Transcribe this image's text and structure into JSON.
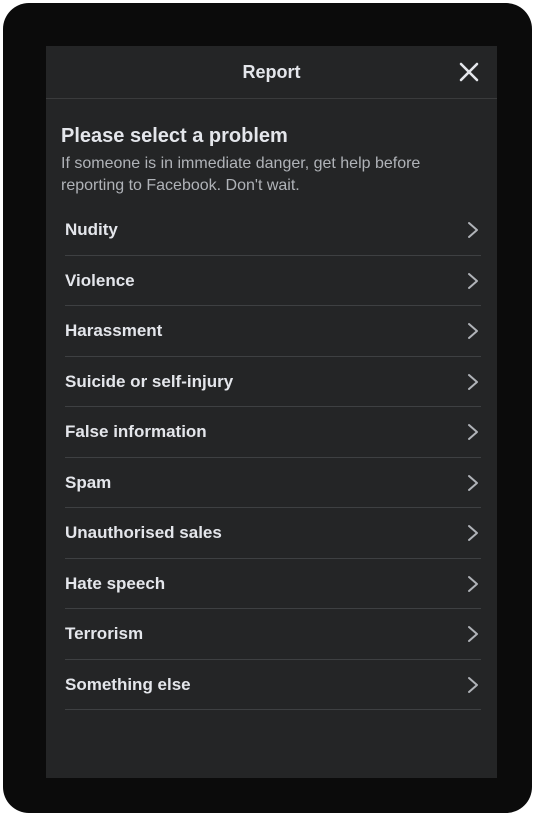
{
  "dialog": {
    "title": "Report",
    "close_icon": "close-icon"
  },
  "prompt": {
    "title": "Please select a problem",
    "subtitle": "If someone is in immediate danger, get help before reporting to Facebook. Don't wait."
  },
  "options": [
    {
      "label": "Nudity",
      "icon": "chevron-right-icon"
    },
    {
      "label": "Violence",
      "icon": "chevron-right-icon"
    },
    {
      "label": "Harassment",
      "icon": "chevron-right-icon"
    },
    {
      "label": "Suicide or self-injury",
      "icon": "chevron-right-icon"
    },
    {
      "label": "False information",
      "icon": "chevron-right-icon"
    },
    {
      "label": "Spam",
      "icon": "chevron-right-icon"
    },
    {
      "label": "Unauthorised sales",
      "icon": "chevron-right-icon"
    },
    {
      "label": "Hate speech",
      "icon": "chevron-right-icon"
    },
    {
      "label": "Terrorism",
      "icon": "chevron-right-icon"
    },
    {
      "label": "Something else",
      "icon": "chevron-right-icon"
    }
  ],
  "colors": {
    "background": "#242526",
    "text_primary": "#e4e6eb",
    "text_secondary": "#b0b3b8",
    "divider": "#3e4042"
  }
}
